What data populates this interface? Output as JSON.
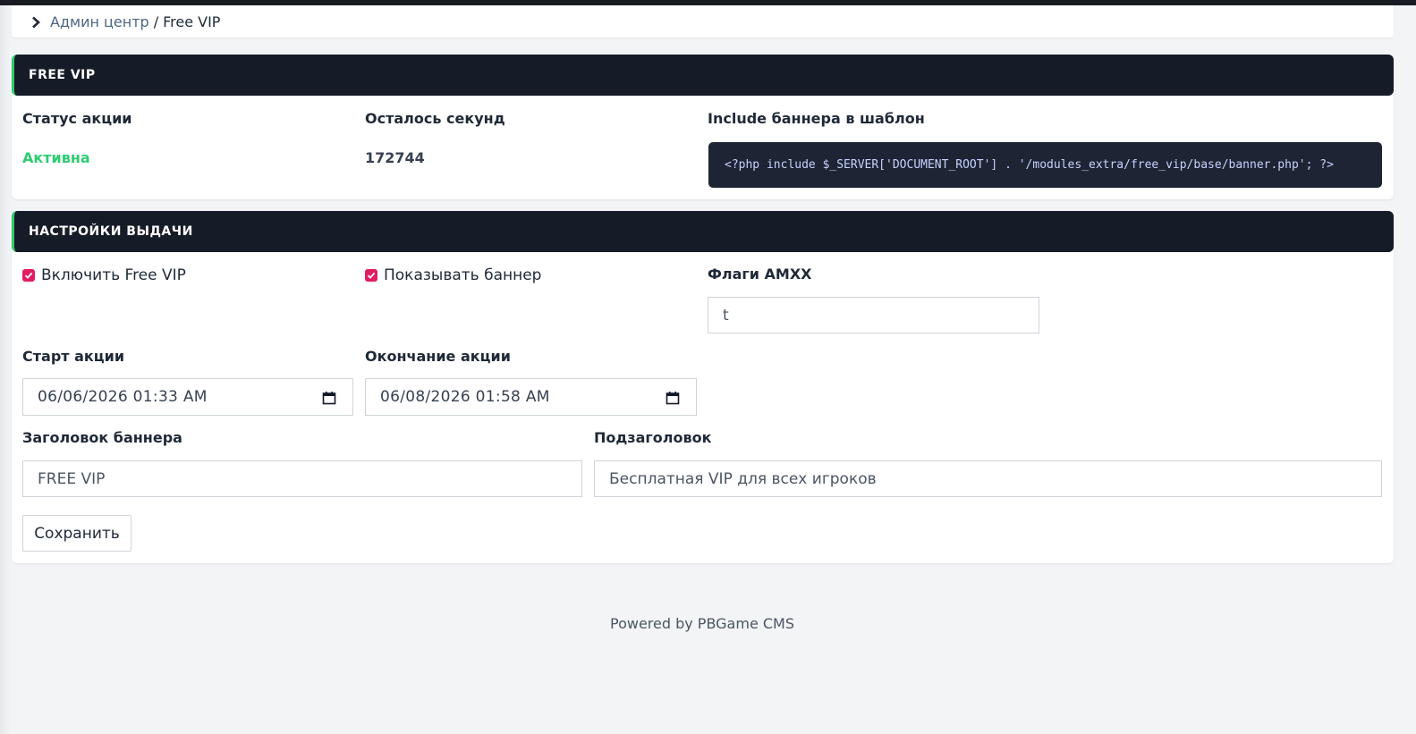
{
  "breadcrumb": {
    "home": "Админ центр",
    "separator": "/",
    "current": "Free VIP"
  },
  "promo_card": {
    "header": "FREE VIP",
    "status_label": "Статус акции",
    "status_value": "Активна",
    "seconds_label": "Осталось секунд",
    "seconds_value": "172744",
    "include_label": "Include баннера в шаблон",
    "include_code": "<?php include $_SERVER['DOCUMENT_ROOT'] . '/modules_extra/free_vip/base/banner.php'; ?>"
  },
  "settings_card": {
    "header": "НАСТРОЙКИ ВЫДАЧИ",
    "enable_label": "Включить Free VIP",
    "enable_checked": true,
    "banner_label": "Показывать баннер",
    "banner_checked": true,
    "flags_label": "Флаги AMXX",
    "flags_value": "t",
    "start_label": "Старт акции",
    "start_value": "06/06/2026 01:33 AM",
    "end_label": "Окончание акции",
    "end_value": "06/08/2026 01:58 AM",
    "title_label": "Заголовок баннера",
    "title_value": "FREE VIP",
    "subtitle_label": "Подзаголовок",
    "subtitle_value": "Бесплатная VIP для всех игроков",
    "save_label": "Сохранить"
  },
  "footer": {
    "text": "Powered by PBGame CMS"
  },
  "colors": {
    "header_bg": "#161c27",
    "accent_green": "#2ecc71",
    "checkbox_pink": "#e11d63",
    "code_bg": "#1e2433"
  }
}
